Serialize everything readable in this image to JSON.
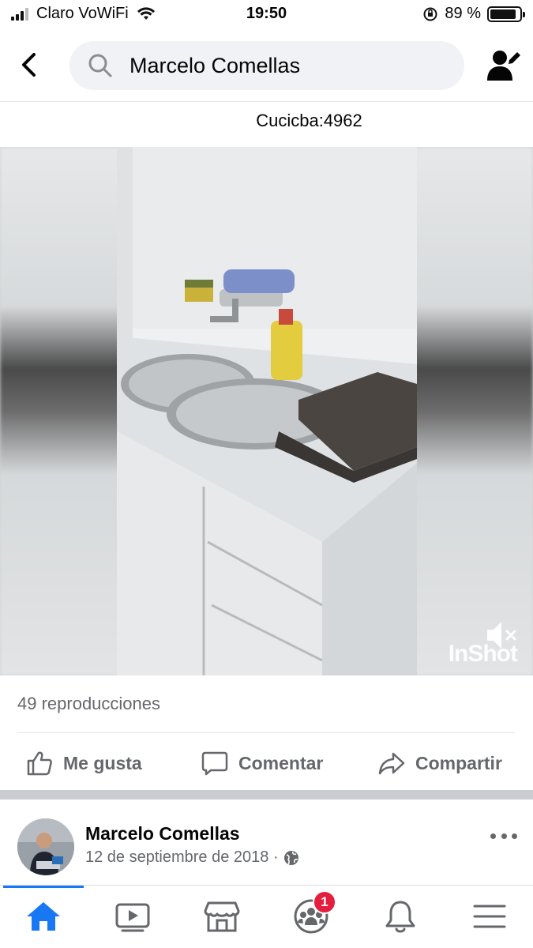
{
  "status_bar": {
    "carrier": "Claro VoWiFi",
    "time": "19:50",
    "battery_percent": "89 %",
    "battery_level": 0.89
  },
  "search": {
    "query": "Marcelo Comellas"
  },
  "post": {
    "caption": "Cucicba:4962",
    "views": "49 reproducciones",
    "watermark": "InShot",
    "author": "Marcelo Comellas",
    "date": "12 de septiembre de 2018 ·"
  },
  "actions": {
    "like": "Me gusta",
    "comment": "Comentar",
    "share": "Compartir"
  },
  "tabs": [
    {
      "name": "home-tab",
      "icon": "home-icon",
      "active": true
    },
    {
      "name": "watch-tab",
      "icon": "video-play-icon",
      "active": false
    },
    {
      "name": "marketplace-tab",
      "icon": "store-icon",
      "active": false
    },
    {
      "name": "groups-tab",
      "icon": "groups-icon",
      "active": false,
      "badge": "1"
    },
    {
      "name": "notifications-tab",
      "icon": "bell-icon",
      "active": false
    },
    {
      "name": "menu-tab",
      "icon": "hamburger-menu-icon",
      "active": false
    }
  ],
  "colors": {
    "accent": "#1877f2",
    "badge": "#e41e3f",
    "secondary_text": "#65676b",
    "search_bg": "#f0f2f5"
  }
}
